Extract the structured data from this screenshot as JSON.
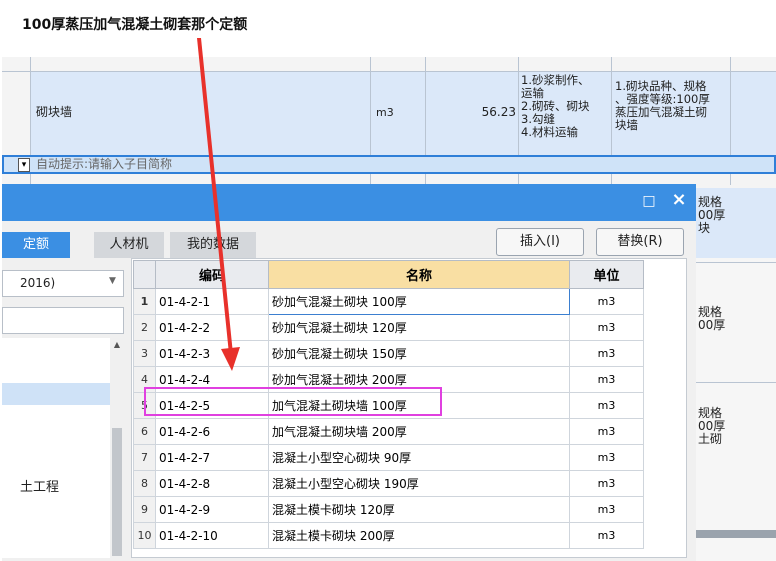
{
  "question": "100厚蒸压加气混凝土砌套那个定额",
  "bg_row": {
    "name": "砌块墙",
    "unit": "m3",
    "quantity": "56.23",
    "work_content": "1.砂浆制作、\n运输\n2.砌砖、砌块\n3.勾缝\n4.材料运输",
    "features": "1.砌块品种、规格\n、强度等级:100厚\n蒸压加气混凝土砌\n块墙"
  },
  "hint_row": {
    "text": "自动提示:请输入子目简称"
  },
  "right_fragments": {
    "f1": "规格\n00厚\n块",
    "f2": "规格\n00厚",
    "f3": "规格\n00厚\n土砌"
  },
  "dialog": {
    "tabs": [
      "定额",
      "人材机",
      "我的数据"
    ],
    "insert_label": "插入(I)",
    "replace_label": "替换(R)",
    "restore_glyph": "□",
    "close_glyph": "×",
    "version_select": "2016)",
    "tree_item": "土工程",
    "columns": [
      "编码",
      "名称",
      "单位"
    ],
    "rows": [
      {
        "no": "1",
        "code": "01-4-2-1",
        "name": "砂加气混凝土砌块 100厚",
        "unit": "m3"
      },
      {
        "no": "2",
        "code": "01-4-2-2",
        "name": "砂加气混凝土砌块 120厚",
        "unit": "m3"
      },
      {
        "no": "3",
        "code": "01-4-2-3",
        "name": "砂加气混凝土砌块 150厚",
        "unit": "m3"
      },
      {
        "no": "4",
        "code": "01-4-2-4",
        "name": "砂加气混凝土砌块 200厚",
        "unit": "m3"
      },
      {
        "no": "5",
        "code": "01-4-2-5",
        "name": "加气混凝土砌块墙 100厚",
        "unit": "m3"
      },
      {
        "no": "6",
        "code": "01-4-2-6",
        "name": "加气混凝土砌块墙 200厚",
        "unit": "m3"
      },
      {
        "no": "7",
        "code": "01-4-2-7",
        "name": "混凝土小型空心砌块 90厚",
        "unit": "m3"
      },
      {
        "no": "8",
        "code": "01-4-2-8",
        "name": "混凝土小型空心砌块 190厚",
        "unit": "m3"
      },
      {
        "no": "9",
        "code": "01-4-2-9",
        "name": "混凝土模卡砌块 120厚",
        "unit": "m3"
      },
      {
        "no": "10",
        "code": "01-4-2-10",
        "name": "混凝土模卡砌块 200厚",
        "unit": "m3"
      }
    ]
  },
  "colors": {
    "highlight_box": "#e040e0",
    "arrow": "#e8312b",
    "title_bar": "#3b8fe3",
    "header_selected": "#f9dfa3"
  }
}
